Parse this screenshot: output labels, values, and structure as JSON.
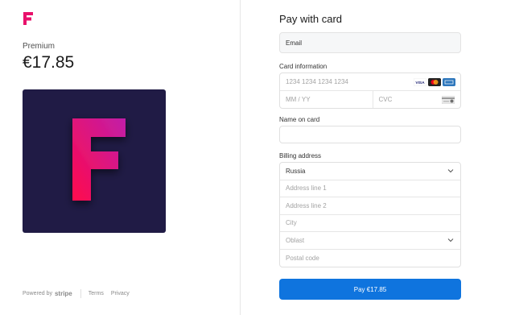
{
  "product": {
    "name": "Premium",
    "price": "€17.85",
    "brand_color": "#e8116b",
    "image_background": "#201b45"
  },
  "footer": {
    "powered_by": "Powered by",
    "stripe": "stripe",
    "terms": "Terms",
    "privacy": "Privacy"
  },
  "form": {
    "title": "Pay with card",
    "email": {
      "value": "Email"
    },
    "card": {
      "label": "Card information",
      "number_placeholder": "1234 1234 1234 1234",
      "expiry_placeholder": "MM / YY",
      "cvc_placeholder": "CVC",
      "icons": [
        "visa-icon",
        "mastercard-icon",
        "amex-icon"
      ]
    },
    "name": {
      "label": "Name on card",
      "value": ""
    },
    "billing": {
      "label": "Billing address",
      "country": "Russia",
      "line1_placeholder": "Address line 1",
      "line2_placeholder": "Address line 2",
      "city_placeholder": "City",
      "oblast_placeholder": "Oblast",
      "postal_placeholder": "Postal code"
    },
    "pay_button": "Pay €17.85",
    "accent_color": "#0f74de"
  }
}
